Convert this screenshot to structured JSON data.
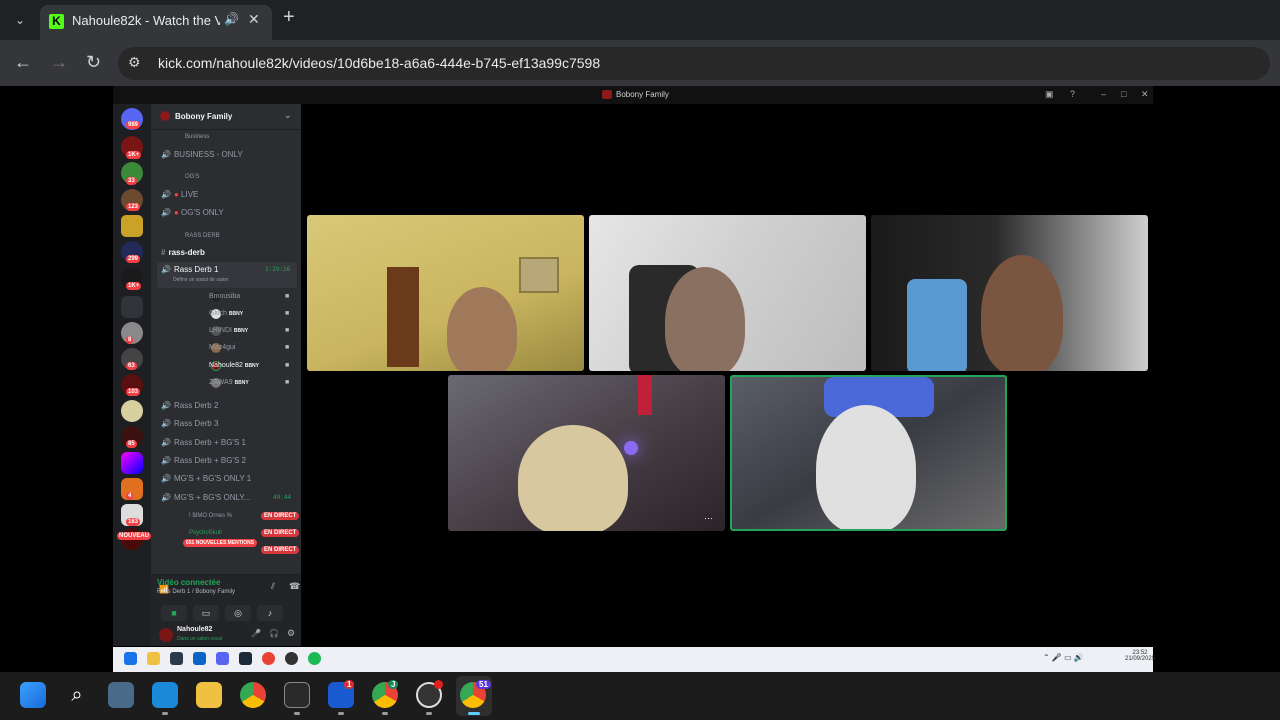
{
  "browser": {
    "tab_title": "Nahoule82k - Watch the VOD",
    "url": "kick.com/nahoule82k/videos/10d6be18-a6a6-444e-b745-ef13a99c7598",
    "favicon_letter": "K"
  },
  "discord": {
    "window_title": "Bobony Family",
    "server_name": "Bobony Family",
    "guild_badges": [
      "989",
      "1K+",
      "33",
      "123",
      "",
      "299",
      "1K+",
      "",
      "8",
      "63",
      "103",
      "",
      "85",
      "",
      "4",
      "163",
      "NOUVEAU"
    ],
    "categories": [
      "Business",
      "OG'S",
      "RASS DERB"
    ],
    "channels": [
      {
        "name": "BUSINESS - ONLY",
        "icon": "speaker-icon"
      },
      {
        "name": "LIVE",
        "icon": "speaker-icon"
      },
      {
        "name": "OG'S ONLY",
        "icon": "speaker-icon"
      },
      {
        "name": "rass-derb",
        "icon": "hash-icon"
      },
      {
        "name": "Rass Derb 1",
        "icon": "speaker-icon",
        "timer": "1:29:16",
        "status": "Définir un statut de salon"
      },
      {
        "name": "Rass Derb 2",
        "icon": "speaker-icon"
      },
      {
        "name": "Rass Derb 3",
        "icon": "speaker-icon"
      },
      {
        "name": "Rass Derb + BG'S 1",
        "icon": "speaker-icon"
      },
      {
        "name": "Rass Derb + BG'S 2",
        "icon": "speaker-icon"
      },
      {
        "name": "MG'S + BG'S ONLY 1",
        "icon": "speaker-icon"
      },
      {
        "name": "MG'S + BG'S ONLY...",
        "icon": "speaker-icon",
        "timer": "49:44"
      }
    ],
    "members": [
      {
        "name": "Bmousiba",
        "tag": ""
      },
      {
        "name": "Glitch",
        "tag": "BBNY"
      },
      {
        "name": "LHINDI",
        "tag": "BBNY"
      },
      {
        "name": "Maz4gui",
        "tag": ""
      },
      {
        "name": "Nahoule82",
        "tag": "BBNY"
      },
      {
        "name": "ZAWA9",
        "tag": "BBNY"
      }
    ],
    "live_members": [
      {
        "name": "! $IMO Ornes %",
        "badge": "EN DIRECT"
      },
      {
        "name": "PsychoSkull",
        "badge": "EN DIRECT"
      },
      {
        "name": "",
        "badge": "EN DIRECT"
      }
    ],
    "mentions_pill": "651 NOUVELLES MENTIONS",
    "voice": {
      "status": "Vidéo connectée",
      "location": "Rass Derb 1 / Bobony Family"
    },
    "user": {
      "name": "Nahoule82",
      "status": "Dans un salon vocal"
    }
  },
  "inner_taskbar": {
    "time": "23:52",
    "date": "21/09/2025"
  },
  "host_taskbar": {
    "badge_one": "1",
    "badge_chrome": "51",
    "badge_green": "J"
  },
  "colors": {
    "kick_green": "#53fc18",
    "discord_bg": "#2b2d31",
    "live_red": "#da373c",
    "voice_green": "#23a559"
  }
}
